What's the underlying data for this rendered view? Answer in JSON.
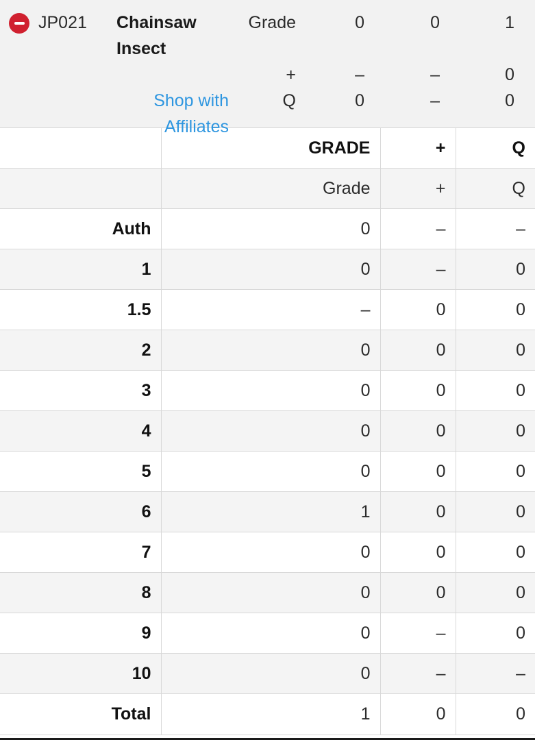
{
  "summary": {
    "status_icon": "minus-circle-icon",
    "status_icon_color": "#d0202f",
    "code": "JP021",
    "title_line1": "Chainsaw",
    "title_line2": "Insect",
    "link_line1": "Shop with",
    "link_line2": "Affiliates",
    "link_color": "#2e96e0",
    "rows": [
      {
        "label": "Grade",
        "values": [
          "0",
          "0",
          "1"
        ]
      },
      {
        "label": "+",
        "values": [
          "–",
          "–",
          "0"
        ]
      },
      {
        "label": "Q",
        "values": [
          "0",
          "–",
          "0"
        ]
      }
    ]
  },
  "grade_table": {
    "header_main": {
      "label": "",
      "grade": "GRADE",
      "plus": "+",
      "q": "Q"
    },
    "header_sub": {
      "label": "",
      "grade": "Grade",
      "plus": "+",
      "q": "Q"
    },
    "rows": [
      {
        "label": "Auth",
        "grade": "0",
        "plus": "–",
        "q": "–"
      },
      {
        "label": "1",
        "grade": "0",
        "plus": "–",
        "q": "0"
      },
      {
        "label": "1.5",
        "grade": "–",
        "plus": "0",
        "q": "0"
      },
      {
        "label": "2",
        "grade": "0",
        "plus": "0",
        "q": "0"
      },
      {
        "label": "3",
        "grade": "0",
        "plus": "0",
        "q": "0"
      },
      {
        "label": "4",
        "grade": "0",
        "plus": "0",
        "q": "0"
      },
      {
        "label": "5",
        "grade": "0",
        "plus": "0",
        "q": "0"
      },
      {
        "label": "6",
        "grade": "1",
        "plus": "0",
        "q": "0"
      },
      {
        "label": "7",
        "grade": "0",
        "plus": "0",
        "q": "0"
      },
      {
        "label": "8",
        "grade": "0",
        "plus": "0",
        "q": "0"
      },
      {
        "label": "9",
        "grade": "0",
        "plus": "–",
        "q": "0"
      },
      {
        "label": "10",
        "grade": "0",
        "plus": "–",
        "q": "–"
      },
      {
        "label": "Total",
        "grade": "1",
        "plus": "0",
        "q": "0"
      }
    ]
  }
}
